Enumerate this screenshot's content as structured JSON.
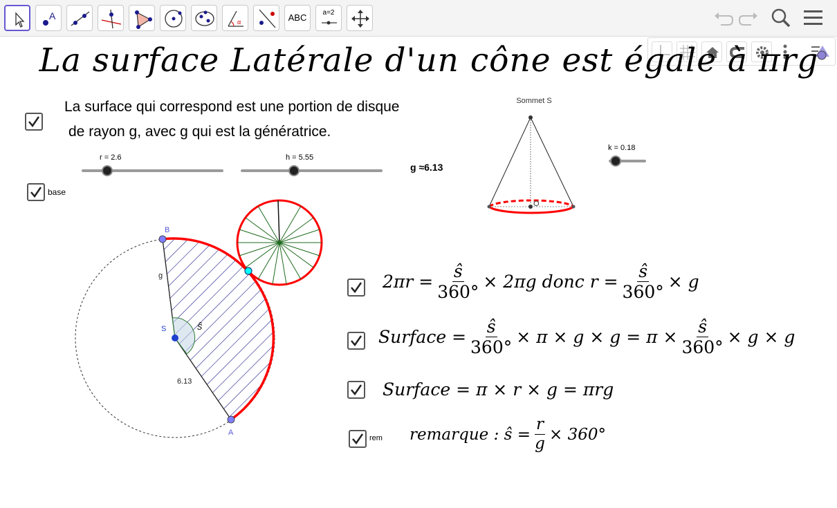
{
  "toolbar": {
    "tools": [
      {
        "name": "move-tool",
        "label": ""
      },
      {
        "name": "point-tool",
        "label": ""
      },
      {
        "name": "line-tool",
        "label": ""
      },
      {
        "name": "perpendicular-tool",
        "label": ""
      },
      {
        "name": "polygon-tool",
        "label": ""
      },
      {
        "name": "circle-tool",
        "label": ""
      },
      {
        "name": "ellipse-tool",
        "label": ""
      },
      {
        "name": "angle-tool",
        "label": ""
      },
      {
        "name": "reflect-tool",
        "label": ""
      },
      {
        "name": "text-tool",
        "label": "ABC"
      },
      {
        "name": "slider-tool",
        "label": "a=2"
      },
      {
        "name": "move-graphics-tool",
        "label": ""
      }
    ]
  },
  "title": "La surface Latérale d'un cône est égale à πrg",
  "description": {
    "line1": "La surface qui correspond est une portion de disque",
    "line2": "de rayon g, avec g qui est la génératrice."
  },
  "sliders": {
    "r": {
      "label": "r = 2.6",
      "value": 2.6
    },
    "h": {
      "label": "h = 5.55",
      "value": 5.55
    },
    "k": {
      "label": "k = 0.18",
      "value": 0.18
    }
  },
  "g_value": "g ≈6.13",
  "base_checkbox_label": "base",
  "rem_checkbox_label": "rem",
  "cone": {
    "apex_label": "Sommet S",
    "center_label": "O"
  },
  "sector": {
    "label_B": "B",
    "label_A": "A",
    "label_S": "S",
    "label_g": "g",
    "label_s_hat": "ŝ",
    "length_label": "6.13"
  },
  "formulas": {
    "f1": {
      "left": "2πr =",
      "num": "ŝ",
      "den": "360°",
      "mid": "× 2πg  donc r =",
      "num2": "ŝ",
      "den2": "360°",
      "end": "× g"
    },
    "f2": {
      "left": "Surface =",
      "num": "ŝ",
      "den": "360°",
      "mid": "× π × g × g = π ×",
      "num2": "ŝ",
      "den2": "360°",
      "end": "× g × g"
    },
    "f3": {
      "text": "Surface = π × r × g = πrg"
    },
    "f4": {
      "left": "remarque : ŝ =",
      "num": "r",
      "den": "g",
      "end": "× 360°"
    }
  },
  "colors": {
    "accent": "#6557d2",
    "red": "#ff0000",
    "hatch": "#1a1a8c",
    "point": "#7f7fff",
    "green": "#1f6b1f",
    "cyan": "#00ffff"
  }
}
